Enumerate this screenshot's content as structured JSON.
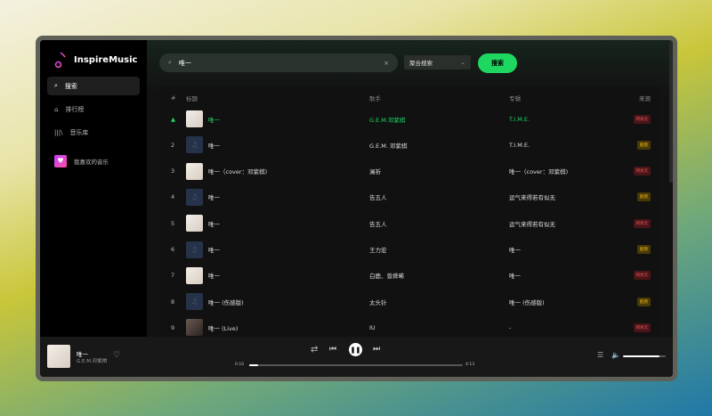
{
  "app": {
    "name": "InspireMusic"
  },
  "sidebar": {
    "items": [
      {
        "label": "搜索",
        "icon": "search-icon",
        "active": true
      },
      {
        "label": "排行榜",
        "icon": "home-icon"
      },
      {
        "label": "音乐库",
        "icon": "library-icon"
      }
    ],
    "favorites": {
      "label": "我喜欢的音乐",
      "icon": "heart-icon"
    }
  },
  "search": {
    "value": "唯一",
    "source_select": "聚合搜索",
    "button": "搜索"
  },
  "table": {
    "headers": {
      "index": "#",
      "title": "标题",
      "artist": "歌手",
      "album": "专辑",
      "source": "来源"
    },
    "rows": [
      {
        "index": "1",
        "title": "唯一",
        "artist": "G.E.M.邓紫棋",
        "album": "T.I.M.E.",
        "source": "网易云",
        "cover": "img",
        "playing": true
      },
      {
        "index": "2",
        "title": "唯一",
        "artist": "G.E.M. 邓紫棋",
        "album": "T.I.M.E.",
        "source": "酷我",
        "cover": "placeholder"
      },
      {
        "index": "3",
        "title": "唯一（cover：邓紫棋)",
        "artist": "澜祈",
        "album": "唯一（cover：邓紫棋)",
        "source": "网易云",
        "cover": "img"
      },
      {
        "index": "4",
        "title": "唯一",
        "artist": "告五人",
        "album": "运气来得若有似无",
        "source": "酷我",
        "cover": "placeholder"
      },
      {
        "index": "5",
        "title": "唯一",
        "artist": "告五人",
        "album": "运气来得若有似无",
        "source": "网易云",
        "cover": "img"
      },
      {
        "index": "6",
        "title": "唯一",
        "artist": "王力宏",
        "album": "唯一",
        "source": "酷我",
        "cover": "placeholder"
      },
      {
        "index": "7",
        "title": "唯一",
        "artist": "白鹿、曾舜晞",
        "album": "唯一",
        "source": "网易云",
        "cover": "img"
      },
      {
        "index": "8",
        "title": "唯一 (伤感版)",
        "artist": "太头针",
        "album": "唯一 (伤感版)",
        "source": "酷我",
        "cover": "placeholder"
      },
      {
        "index": "9",
        "title": "唯一 (Live)",
        "artist": "IU",
        "album": "-",
        "source": "网易云",
        "cover": "dark"
      }
    ]
  },
  "player": {
    "title": "唯一",
    "artist": "G.E.M.邓紫棋",
    "current": "0:10",
    "duration": "4:13",
    "progress_percent": 4,
    "volume_percent": 85,
    "liked": false
  },
  "colors": {
    "accent": "#1ed760",
    "netease": "#e0555b",
    "kuwo": "#e6b422"
  }
}
